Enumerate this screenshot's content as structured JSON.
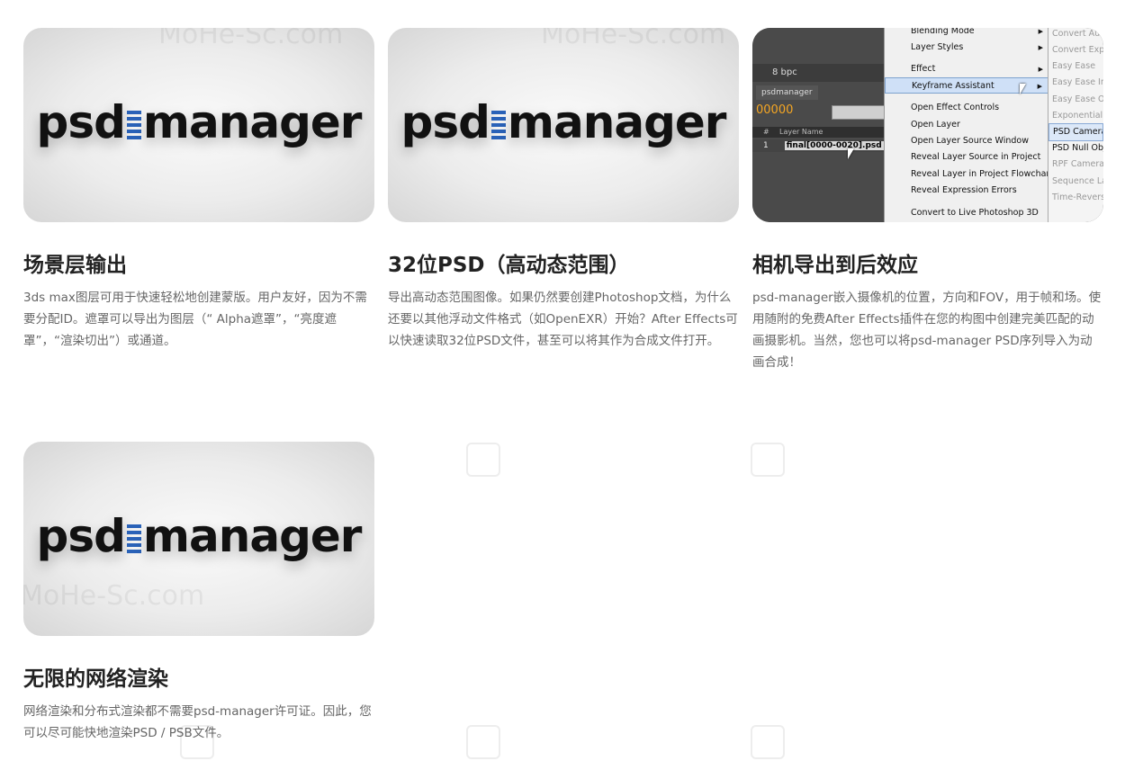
{
  "logo": {
    "left": "psd",
    "right": "manager"
  },
  "watermark": "MoHe-Sc.com",
  "cards": [
    {
      "title": "场景层输出",
      "description": "3ds max图层可用于快速轻松地创建蒙版。用户友好，因为不需要分配ID。遮罩可以导出为图层（“ Alpha遮罩”，“亮度遮罩”，“渲染切出”）或通道。"
    },
    {
      "title": "32位PSD（高动态范围）",
      "description": "导出高动态范围图像。如果仍然要创建Photoshop文档，为什么还要以其他浮动文件格式（如OpenEXR）开始？After Effects可以快速读取32位PSD文件，甚至可以将其作为合成文件打开。"
    },
    {
      "title": "相机导出到后效应",
      "description": "psd-manager嵌入摄像机的位置，方向和FOV，用于帧和场。使用随附的免费After Effects插件在您的构图中创建完美匹配的动画摄影机。当然，您也可以将psd-manager PSD序列导入为动画合成！"
    },
    {
      "title": "无限的网络渲染",
      "description": "网络渲染和分布式渲染都不需要psd-manager许可证。因此，您可以尽可能快地渲染PSD / PSB文件。"
    }
  ],
  "ae_screenshot": {
    "toolbar_bpc": "8 bpc",
    "tab_label": "psdmanager",
    "timecode": "00000",
    "layer_col_header": "Layer Name",
    "layer_num_header": "#",
    "layer_index": "1",
    "layer_name": "final[0000-0020].psd",
    "menu_items": [
      {
        "label": "Blending Mode",
        "submenu": true
      },
      {
        "label": "Layer Styles",
        "submenu": true
      },
      {
        "label": "Effect",
        "submenu": true
      },
      {
        "label": "Keyframe Assistant",
        "submenu": true,
        "highlighted": true
      },
      {
        "label": "Open Effect Controls",
        "submenu": false
      },
      {
        "label": "Open Layer",
        "submenu": false
      },
      {
        "label": "Open Layer Source Window",
        "submenu": false
      },
      {
        "label": "Reveal Layer Source in Project",
        "submenu": false
      },
      {
        "label": "Reveal Layer in Project Flowchart",
        "submenu": false
      },
      {
        "label": "Reveal Expression Errors",
        "submenu": false
      },
      {
        "label": "Convert to Live Photoshop 3D",
        "submenu": false
      }
    ],
    "submenu_items": [
      {
        "label": "Convert Audio to Keyframes",
        "state": "disabled"
      },
      {
        "label": "Convert Expression to Keyframes",
        "state": "disabled"
      },
      {
        "label": "Easy Ease",
        "state": "disabled"
      },
      {
        "label": "Easy Ease In",
        "state": "disabled"
      },
      {
        "label": "Easy Ease Out",
        "state": "disabled"
      },
      {
        "label": "Exponential Scale",
        "state": "disabled"
      },
      {
        "label": "PSD Camera Import",
        "state": "selected"
      },
      {
        "label": "PSD Null Objects",
        "state": "enabled"
      },
      {
        "label": "RPF Camera Import",
        "state": "disabled"
      },
      {
        "label": "Sequence Layers",
        "state": "disabled"
      },
      {
        "label": "Time-Reverse Keyframes",
        "state": "disabled"
      }
    ]
  }
}
